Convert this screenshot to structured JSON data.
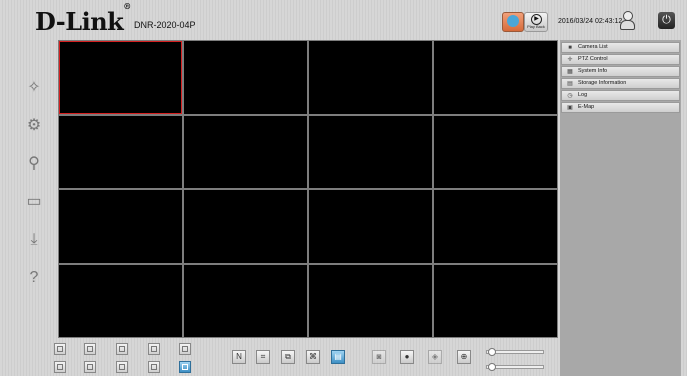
{
  "header": {
    "logo_text": "D-Link",
    "registered_mark": "®",
    "model": "DNR-2020-04P",
    "datetime": "2016/03/24  02:43:12",
    "live_icon": "live-view-icon",
    "playback_label": "Play Back",
    "user_icon": "user-icon",
    "power_icon": "power-icon"
  },
  "left_toolbar": [
    {
      "name": "setup-wizard-icon",
      "glyph": "✧"
    },
    {
      "name": "settings-icon",
      "glyph": "⚙"
    },
    {
      "name": "search-icon",
      "glyph": "⚲"
    },
    {
      "name": "display-icon",
      "glyph": "▭"
    },
    {
      "name": "download-icon",
      "glyph": "⤓"
    },
    {
      "name": "help-icon",
      "glyph": "?"
    }
  ],
  "grid": {
    "rows": 4,
    "cols": 4,
    "selected_index": 0
  },
  "panel": {
    "items": [
      {
        "label": "Camera List",
        "icon": "camera-list-icon",
        "glyph": "■"
      },
      {
        "label": "PTZ Control",
        "icon": "ptz-control-icon",
        "glyph": "✛"
      },
      {
        "label": "System Info",
        "icon": "system-info-icon",
        "glyph": "▦"
      },
      {
        "label": "Storage Information",
        "icon": "storage-icon",
        "glyph": "▤"
      },
      {
        "label": "Log",
        "icon": "log-icon",
        "glyph": "◷"
      },
      {
        "label": "E-Map",
        "icon": "e-map-icon",
        "glyph": "▣"
      }
    ]
  },
  "bottom": {
    "layout_buttons_row1": [
      "layout-1",
      "layout-4",
      "layout-6",
      "layout-8",
      "layout-9"
    ],
    "layout_buttons_row2": [
      "layout-10",
      "layout-13",
      "layout-16a",
      "layout-16b",
      "layout-16"
    ],
    "active_layout": "layout-16",
    "controls": [
      {
        "name": "normal-mode-button",
        "glyph": "N",
        "active": false,
        "dim": false
      },
      {
        "name": "full-screen-button",
        "glyph": "⌗",
        "active": false,
        "dim": false
      },
      {
        "name": "sequence-button",
        "glyph": "⧉",
        "active": false,
        "dim": false
      },
      {
        "name": "group-view-button",
        "glyph": "⌘",
        "active": false,
        "dim": false
      },
      {
        "name": "display-info-button",
        "glyph": "▤",
        "active": true,
        "dim": false
      },
      {
        "name": "snapshot-button",
        "glyph": "◙",
        "active": false,
        "dim": true
      },
      {
        "name": "record-button",
        "glyph": "●",
        "active": false,
        "dim": false
      },
      {
        "name": "audio-button",
        "glyph": "◈",
        "active": false,
        "dim": true
      },
      {
        "name": "zoom-button",
        "glyph": "⊕",
        "active": false,
        "dim": false
      }
    ],
    "sliders": [
      {
        "name": "volume-slider",
        "value": 0.12
      },
      {
        "name": "brightness-slider",
        "value": 0.12
      }
    ]
  }
}
